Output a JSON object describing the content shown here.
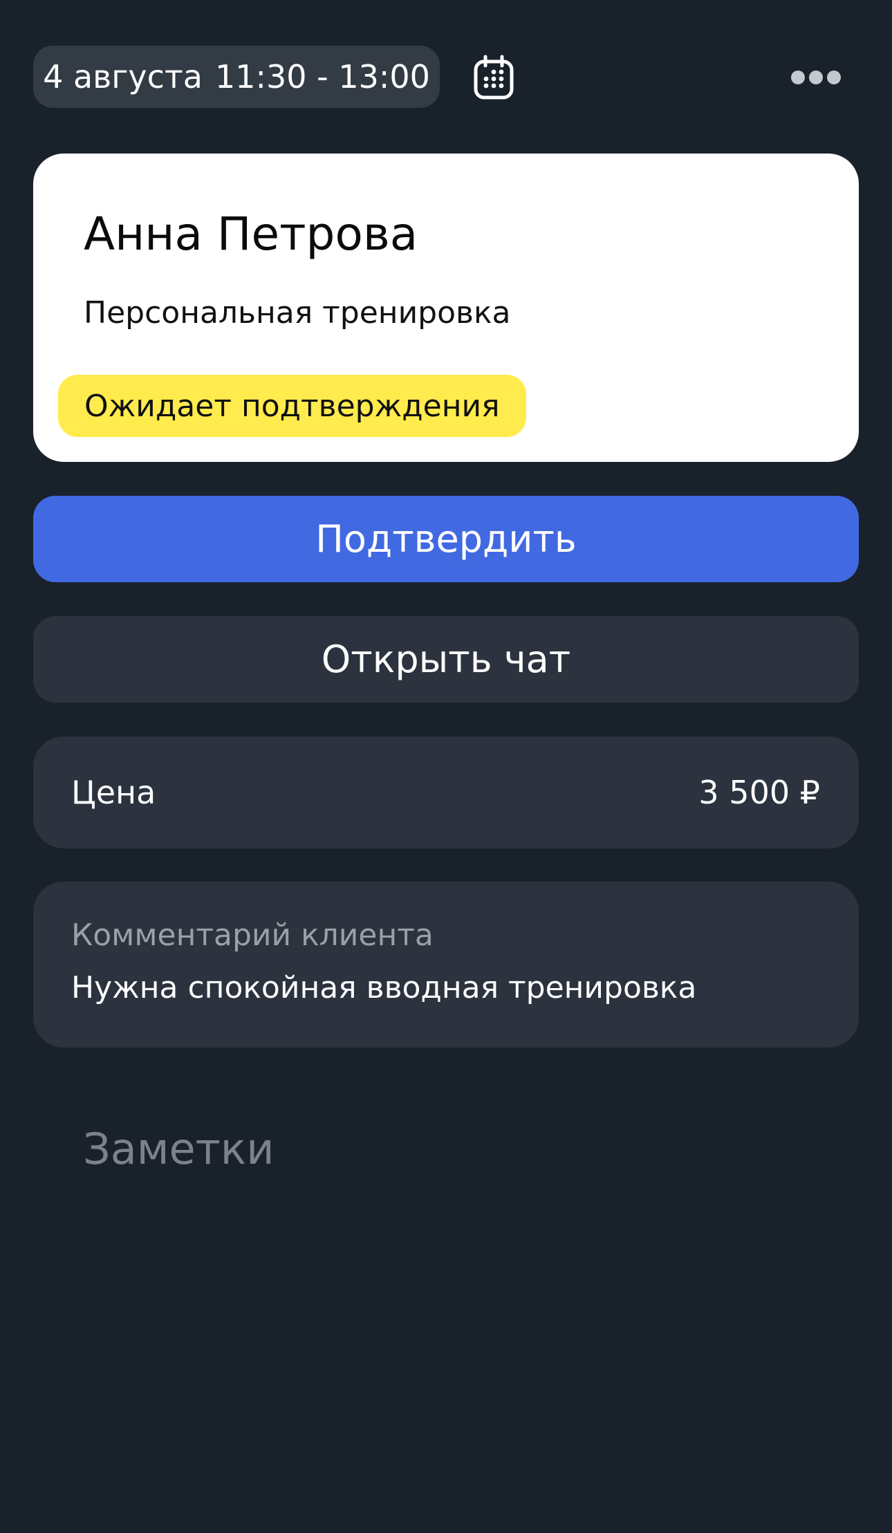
{
  "header": {
    "date": "4 августа",
    "time_range": "11:30 - 13:00",
    "calendar_icon": "calendar-icon",
    "more_icon": "more-horizontal-icon"
  },
  "client": {
    "name": "Анна Петрова",
    "service": "Персональная тренировка",
    "status": "Ожидает подтверждения",
    "status_color": "#ffeb4d"
  },
  "actions": {
    "confirm_label": "Подтвердить",
    "chat_label": "Открыть чат",
    "confirm_color": "#4169e1"
  },
  "price": {
    "label": "Цена",
    "value": "3 500 ₽"
  },
  "comment": {
    "label": "Комментарий клиента",
    "text": "Нужна спокойная вводная тренировка"
  },
  "notes": {
    "placeholder": "Заметки"
  }
}
